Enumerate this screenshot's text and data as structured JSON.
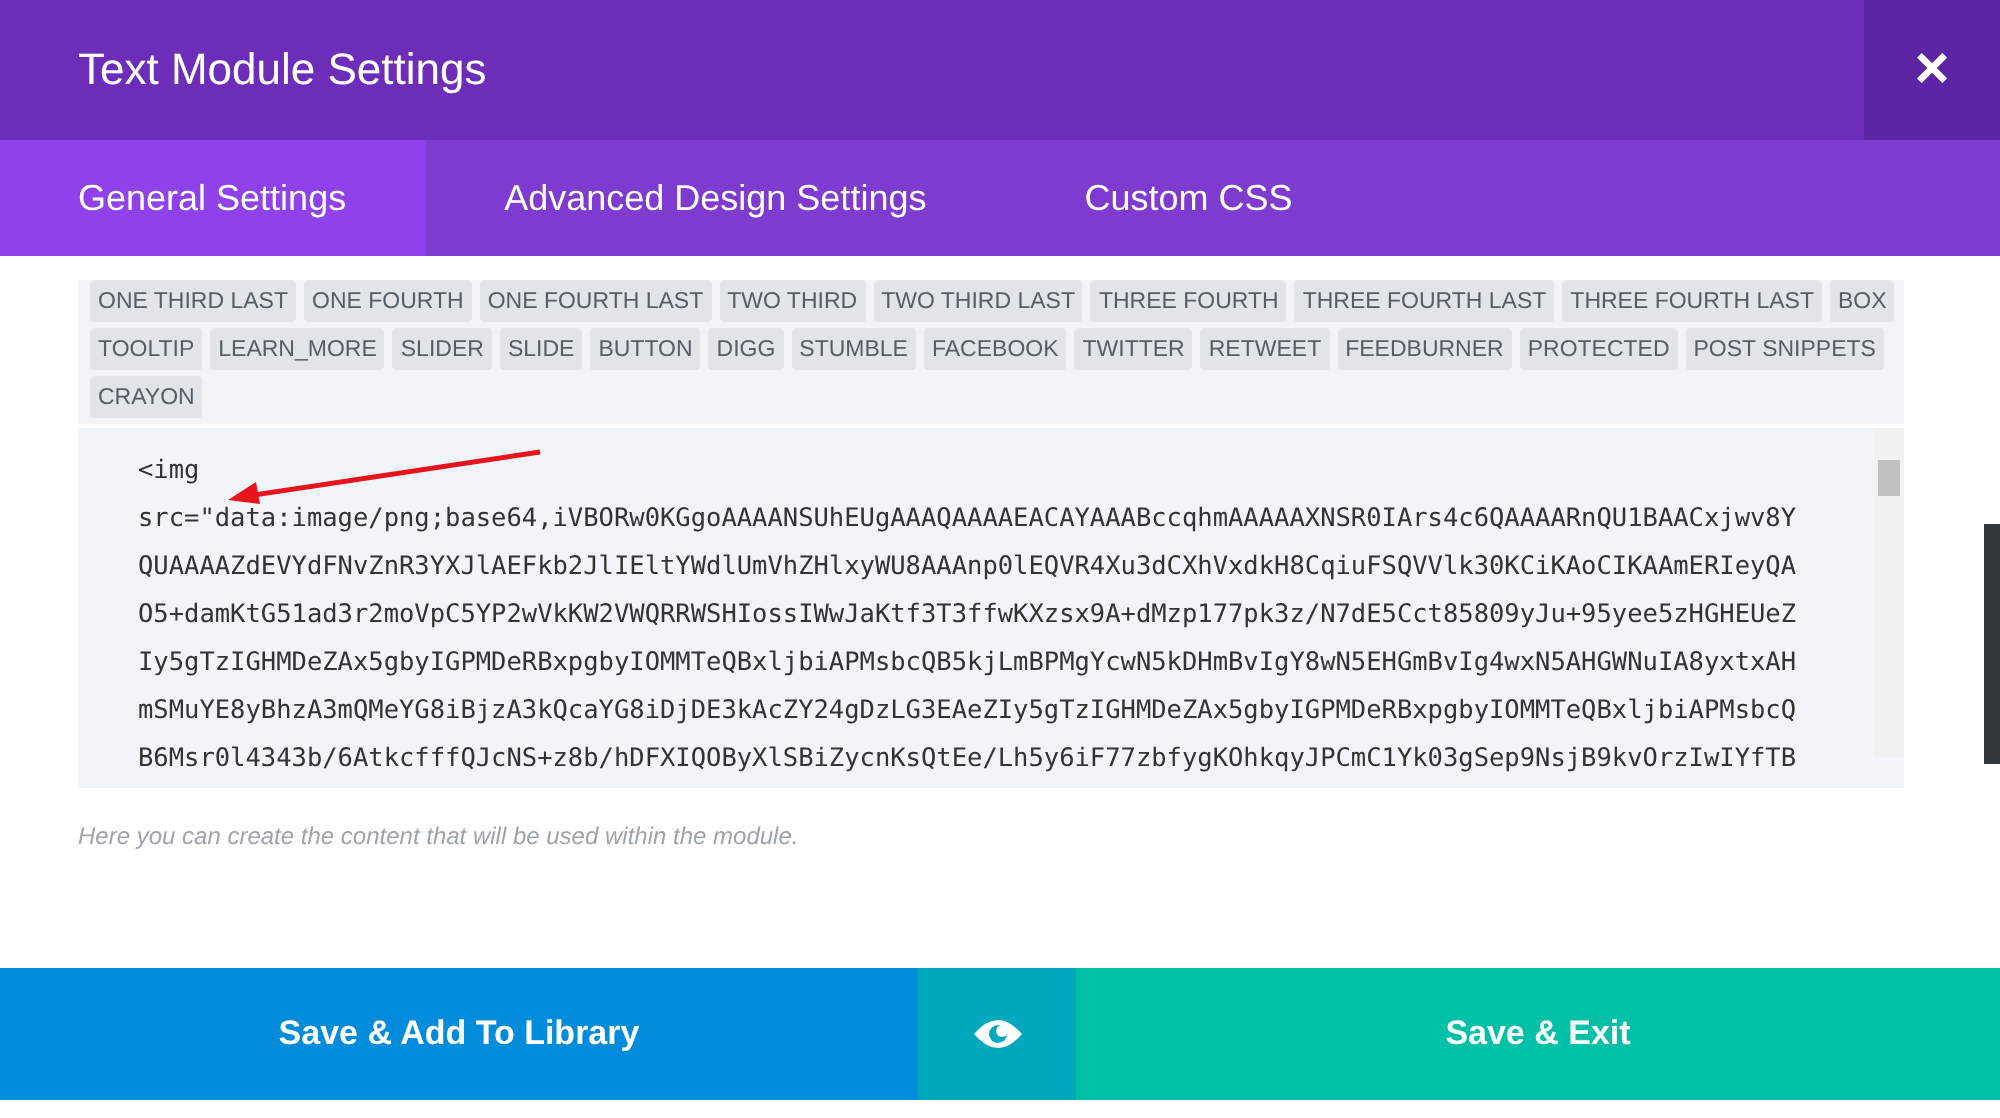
{
  "window": {
    "title": "Text Module Settings",
    "close": "×"
  },
  "tabs": [
    {
      "label": "General Settings",
      "selected": true
    },
    {
      "label": "Advanced Design Settings",
      "selected": false
    },
    {
      "label": "Custom CSS",
      "selected": false
    }
  ],
  "toolbar_rows": [
    [
      "ONE THIRD LAST",
      "ONE FOURTH",
      "ONE FOURTH LAST",
      "TWO THIRD",
      "TWO THIRD LAST",
      "THREE FOURTH",
      "THREE FOURTH LAST",
      "THREE FOURTH LAST",
      "BOX"
    ],
    [
      "TOOLTIP",
      "LEARN_MORE",
      "SLIDER",
      "SLIDE",
      "BUTTON",
      "DIGG",
      "STUMBLE",
      "FACEBOOK",
      "TWITTER",
      "RETWEET",
      "FEEDBURNER",
      "PROTECTED",
      "POST SNIPPETS"
    ],
    [
      "CRAYON"
    ]
  ],
  "editor_lines": [
    "<img",
    "src=\"data:image/png;base64,iVBORw0KGgoAAAANSUhEUgAAAQAAAAEACAYAAABccqhmAAAAAXNSR0IArs4c6QAAAARnQU1BAACxjwv8Y",
    "QUAAAAZdEVYdFNvZnR3YXJlAEFkb2JlIEltYWdlUmVhZHlxyWU8AAAnp0lEQVR4Xu3dCXhVxdkH8CqiuFSQVVlk30KCiKAoCIKAAmERIeyQA",
    "O5+damKtG51ad3r2moVpC5YP2wVkKW2VWQRRWSHIossIWwJaKtf3T3ffwKXzsx9A+dMzp177pk3z/N7dE5Cct85809yJu+95yee5zHGHEUeZ",
    "Iy5gTzIGHMDeZAx5gbyIGPMDeRBxpgbyIOMMTeQBxljbiAPMsbcQB5kjLmBPMgYcwN5kDHmBvIgY8wN5EHGmBvIg4wxN5AHGWNuIA8yxtxAH",
    "mSMuYE8yBhzA3mQMeYG8iBjzA3kQcaYG8iDjDE3kAcZY24gDzLG3EAeZIy5gTzIGHMDeZAx5gbyIGPMDeRBxpgbyIOMMTeQBxljbiAPMsbcQ",
    "B6Msr0l4343b/6AtkcfffQJcNS+z8b/hDFXIQOByXlSBiZycnKsQtEe/Lh5y6iF77zbfygKOhkqyJPCmC1Yk03gSep9NsjB9kvOrzIwIYfTB"
  ],
  "hint": "Here you can create the content that will be used within the module.",
  "footer": {
    "library_button": "Save & Add To Library",
    "exit_button": "Save & Exit"
  }
}
